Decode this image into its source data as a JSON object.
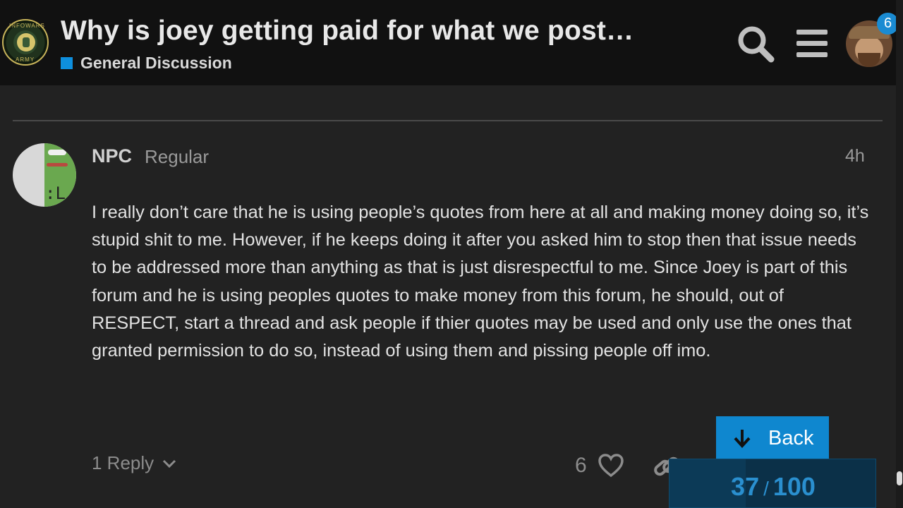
{
  "header": {
    "logo_text_top": "INFOWARS",
    "logo_text_bottom": "ARMY",
    "topic_title": "Why is joey getting paid for what we post…",
    "category": {
      "label": "General Discussion",
      "color": "#0e8fdd"
    },
    "notification_count": "6",
    "icons": [
      "search-icon",
      "hamburger-menu-icon",
      "user-avatar"
    ]
  },
  "post": {
    "username": "NPC",
    "user_title": "Regular",
    "time": "4h",
    "body": "I really don’t care that he is using people’s quotes from here at all and making money doing so, it’s stupid shit to me. However, if he keeps doing it after you asked him to stop then that issue needs to be addressed more than anything as that is just disrespectful to me. Since Joey is part of this forum and he is using peoples quotes to make money from this forum, he should, out of RESPECT, start a thread and ask people if thier quotes may be used and only use the ones that granted permission to do so, instead of using them and pissing people off imo.",
    "replies_label": "1 Reply",
    "like_count": "6"
  },
  "navigation": {
    "back_label": "Back",
    "progress_current": "37",
    "progress_separator": "/",
    "progress_total": "100",
    "progress_fraction": 0.37
  },
  "colors": {
    "accent": "#0f87cf",
    "background": "#222222",
    "header_background": "#111111"
  }
}
